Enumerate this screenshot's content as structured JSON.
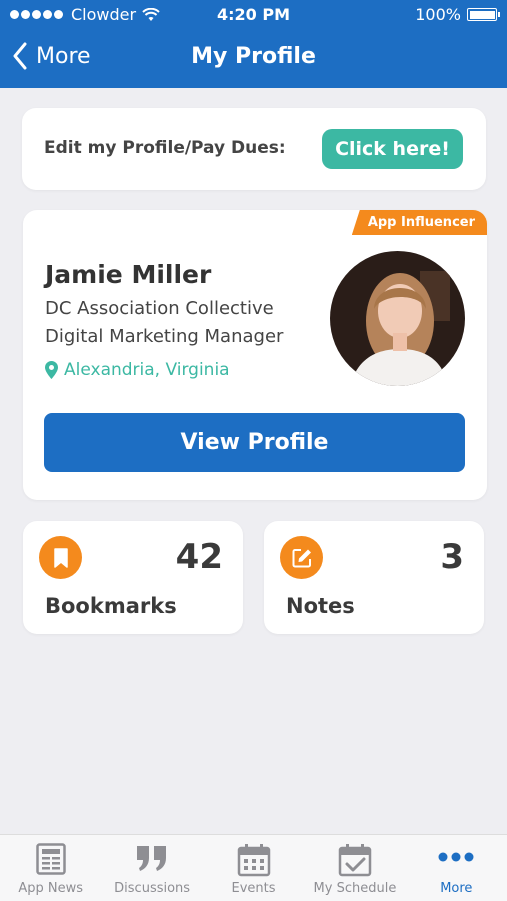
{
  "status_bar": {
    "carrier": "Clowder",
    "time": "4:20 PM",
    "battery": "100%"
  },
  "nav": {
    "back_label": "More",
    "title": "My Profile"
  },
  "edit_card": {
    "label": "Edit my Profile/Pay Dues:",
    "button_label": "Click here!"
  },
  "profile": {
    "badge": "App Influencer",
    "name": "Jamie Miller",
    "organization": "DC Association Collective",
    "job_title": "Digital Marketing Manager",
    "location": "Alexandria, Virginia",
    "view_button": "View Profile"
  },
  "stats": {
    "bookmarks": {
      "count": "42",
      "label": "Bookmarks"
    },
    "notes": {
      "count": "3",
      "label": "Notes"
    }
  },
  "tabs": [
    {
      "label": "App News",
      "icon": "newspaper-icon"
    },
    {
      "label": "Discussions",
      "icon": "quote-icon"
    },
    {
      "label": "Events",
      "icon": "calendar-icon"
    },
    {
      "label": "My Schedule",
      "icon": "calendar-check-icon"
    },
    {
      "label": "More",
      "icon": "more-dots-icon",
      "active": true
    }
  ],
  "colors": {
    "primary_blue": "#1d6ec3",
    "teal": "#3cb8a3",
    "orange": "#f48a1d",
    "background": "#eeeef2"
  }
}
